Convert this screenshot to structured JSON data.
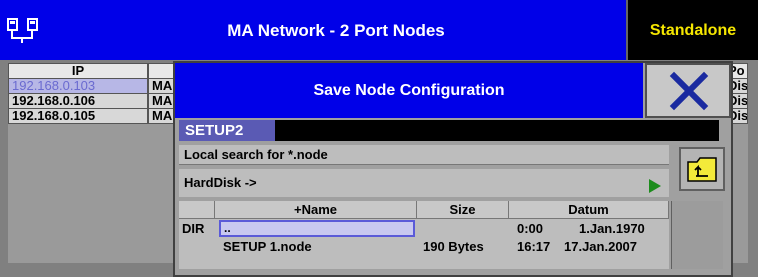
{
  "app": {
    "title": "MA Network - 2 Port Nodes",
    "mode": "Standalone",
    "icon": "network-icon"
  },
  "bg_table": {
    "columns": [
      "IP",
      "",
      "Po"
    ],
    "rows": [
      {
        "ip": "192.168.0.103",
        "name": "MA",
        "port": "Dis"
      },
      {
        "ip": "192.168.0.106",
        "name": "MA",
        "port": "Dis"
      },
      {
        "ip": "192.168.0.105",
        "name": "MA",
        "port": "Dis"
      }
    ]
  },
  "dialog": {
    "title": "Save Node Configuration",
    "filename": "SETUP2",
    "search_label": "Local search for *.node",
    "drive_label": "HardDisk ->",
    "file_table": {
      "headers": {
        "type": "",
        "name": "+Name",
        "size": "Size",
        "date": "Datum"
      },
      "rows": [
        {
          "type": "DIR",
          "name": "..",
          "size": "",
          "time": "0:00",
          "date": "1.Jan.1970"
        },
        {
          "type": "",
          "name": "SETUP 1.node",
          "size": "190 Bytes",
          "time": "16:17",
          "date": "17.Jan.2007"
        }
      ]
    }
  },
  "colors": {
    "title_blue": "#0000e8",
    "mode_text": "#f5e600",
    "selected_row_text": "#6a6ad0",
    "close_x": "#1a2aa0"
  }
}
